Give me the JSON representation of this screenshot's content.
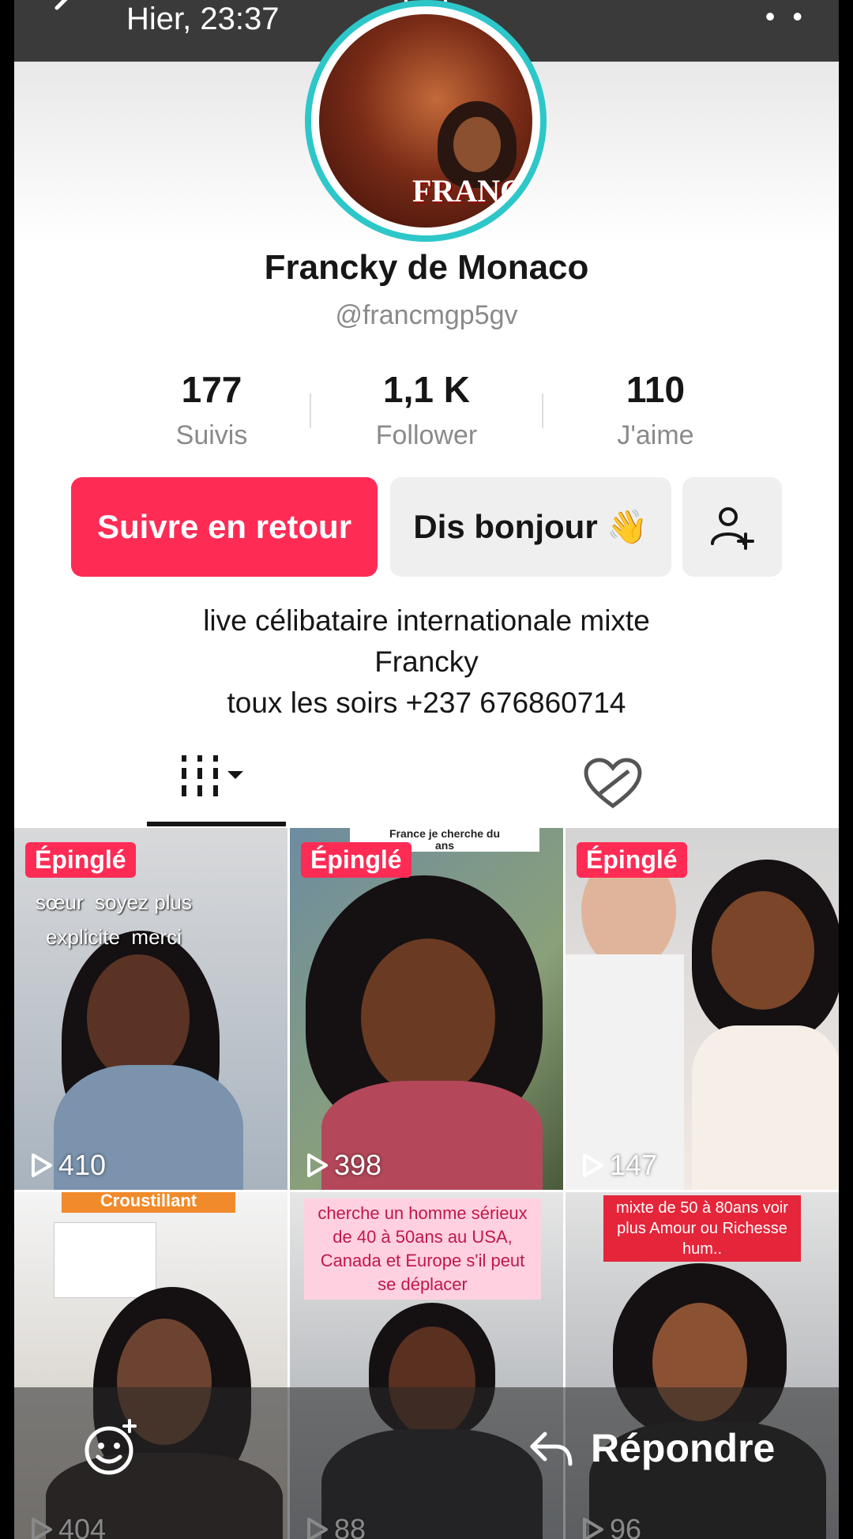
{
  "story": {
    "timestamp": "Hier, 23:37"
  },
  "profile": {
    "display_name": "Francky de Monaco",
    "username": "@francmgp5gv",
    "avatar_text": "FRANCK"
  },
  "stats": [
    {
      "value": "177",
      "label": "Suivis"
    },
    {
      "value": "1,1 K",
      "label": "Follower"
    },
    {
      "value": "110",
      "label": "J'aime"
    }
  ],
  "actions": {
    "follow_back": "Suivre en retour",
    "say_hello": "Dis bonjour 👋"
  },
  "bio": {
    "line1": "live célibataire internationale mixte",
    "line2": "Francky",
    "line3": "toux les soirs +237 676860714"
  },
  "videos": [
    {
      "pinned": "Épinglé",
      "views": "410",
      "caption": "âme\nsœur  soyez plus\nexplicite  merci"
    },
    {
      "pinned": "Épinglé",
      "views": "398",
      "caption": "France je cherche du\nans"
    },
    {
      "pinned": "Épinglé",
      "views": "147",
      "caption": ""
    },
    {
      "views": "404",
      "caption": "Croustillant"
    },
    {
      "views": "88",
      "caption": "cherche un homme sérieux de 40 à 50ans au USA, Canada et Europe s'il peut se déplacer"
    },
    {
      "views": "96",
      "caption": "mixte de 50 à 80ans voir plus Amour ou Richesse hum.."
    }
  ],
  "reply": {
    "label": "Répondre"
  },
  "colors": {
    "accent": "#fe2c55",
    "ring": "#2ec7c9"
  }
}
